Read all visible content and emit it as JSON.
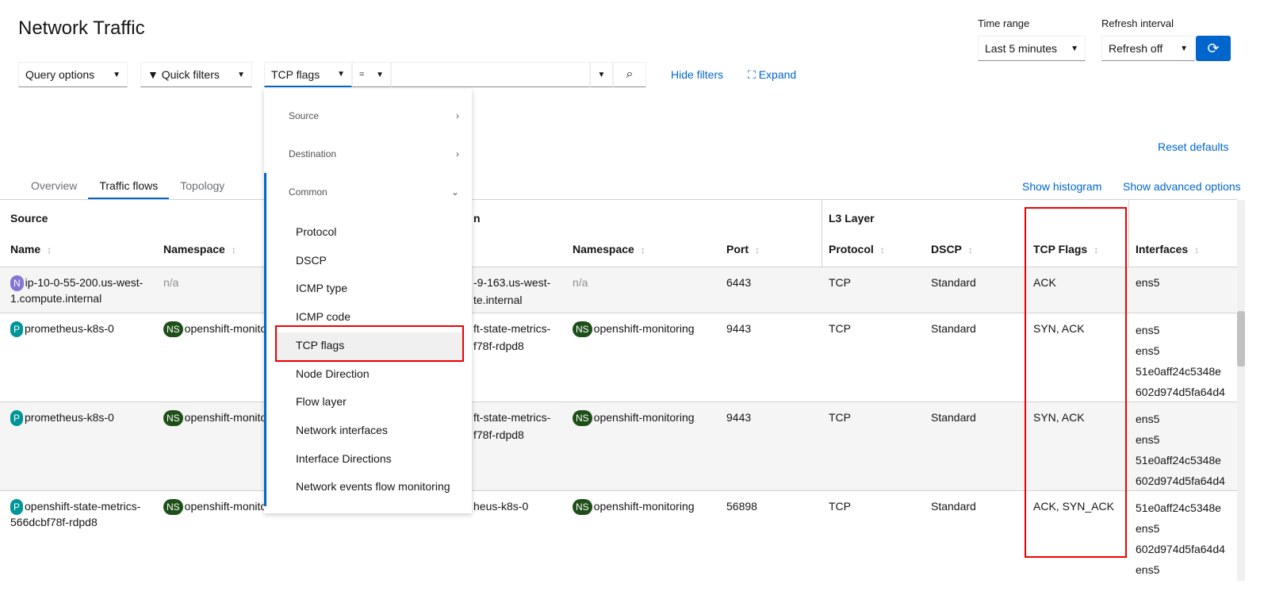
{
  "header": {
    "title": "Network Traffic",
    "time_range_label": "Time range",
    "time_range_value": "Last 5 minutes",
    "refresh_label": "Refresh interval",
    "refresh_value": "Refresh off"
  },
  "toolbar": {
    "query_options": "Query options",
    "quick_filters": "Quick filters",
    "filter_field": "TCP flags",
    "operator": "=",
    "value": "",
    "hide_filters": "Hide filters",
    "expand": "Expand",
    "reset_defaults": "Reset defaults",
    "show_histogram": "Show histogram",
    "show_advanced": "Show advanced options"
  },
  "tabs": [
    "Overview",
    "Traffic flows",
    "Topology"
  ],
  "menu": {
    "groups": [
      "Source",
      "Destination",
      "Common"
    ],
    "items": [
      "Protocol",
      "DSCP",
      "ICMP type",
      "ICMP code",
      "TCP flags",
      "Node Direction",
      "Flow layer",
      "Network interfaces",
      "Interface Directions",
      "Network events flow monitoring"
    ],
    "selected": "TCP flags"
  },
  "table": {
    "groups": {
      "source": "Source",
      "destination": "n",
      "l3": "L3 Layer"
    },
    "columns": [
      "Name",
      "Namespace",
      "Namespace",
      "Port",
      "Protocol",
      "DSCP",
      "TCP Flags",
      "Interfaces"
    ],
    "rows": [
      {
        "src_badge": "N",
        "src_name": "ip-10-0-55-200.us-west-1.compute.internal",
        "src_ns_badge": "",
        "src_ns": "n/a",
        "dst_name": [
          "-9-163.us-west-",
          "te.internal"
        ],
        "dst_ns_badge": "",
        "dst_ns": "n/a",
        "port": "6443",
        "protocol": "TCP",
        "dscp": "Standard",
        "flags": "ACK",
        "interfaces": [
          "ens5"
        ]
      },
      {
        "src_badge": "P",
        "src_name": "prometheus-k8s-0",
        "src_ns_badge": "NS",
        "src_ns": "openshift-monito",
        "dst_name": [
          "ft-state-metrics-",
          "f78f-rdpd8"
        ],
        "dst_ns_badge": "NS",
        "dst_ns": "openshift-monitoring",
        "port": "9443",
        "protocol": "TCP",
        "dscp": "Standard",
        "flags": "SYN, ACK",
        "interfaces": [
          "ens5",
          "ens5",
          "51e0aff24c5348e",
          "602d974d5fa64d4"
        ]
      },
      {
        "src_badge": "P",
        "src_name": "prometheus-k8s-0",
        "src_ns_badge": "NS",
        "src_ns": "openshift-monito",
        "dst_name": [
          "ft-state-metrics-",
          "f78f-rdpd8"
        ],
        "dst_ns_badge": "NS",
        "dst_ns": "openshift-monitoring",
        "port": "9443",
        "protocol": "TCP",
        "dscp": "Standard",
        "flags": "SYN, ACK",
        "interfaces": [
          "ens5",
          "ens5",
          "51e0aff24c5348e",
          "602d974d5fa64d4"
        ]
      },
      {
        "src_badge": "P",
        "src_name": "openshift-state-metrics-566dcbf78f-rdpd8",
        "src_ns_badge": "NS",
        "src_ns": "openshift-monito",
        "dst_name": [
          "heus-k8s-0"
        ],
        "dst_ns_badge": "NS",
        "dst_ns": "openshift-monitoring",
        "port": "56898",
        "protocol": "TCP",
        "dscp": "Standard",
        "flags": "ACK, SYN_ACK",
        "interfaces": [
          "51e0aff24c5348e",
          "ens5",
          "602d974d5fa64d4",
          "ens5"
        ]
      }
    ]
  },
  "colors": {
    "accent": "#0066cc",
    "refresh_button": "#0066cc",
    "highlight": "#ee0000",
    "node_badge": "#8476d1",
    "pod_badge": "#009596",
    "ns_badge": "#1e4f18"
  }
}
